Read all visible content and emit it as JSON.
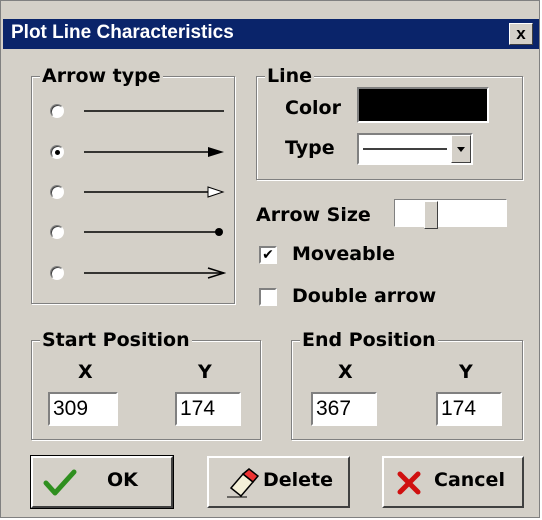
{
  "window": {
    "title": "Plot Line Characteristics",
    "close_label": "x"
  },
  "arrow_type": {
    "legend": "Arrow type",
    "selected_index": 1,
    "options": [
      {
        "style": "plain"
      },
      {
        "style": "filled-arrowhead"
      },
      {
        "style": "open-arrowhead"
      },
      {
        "style": "dot-end"
      },
      {
        "style": "line-arrowhead"
      }
    ]
  },
  "line": {
    "legend": "Line",
    "color_label": "Color",
    "color_value": "#000000",
    "type_label": "Type"
  },
  "arrow_size": {
    "label": "Arrow Size",
    "level": 0.3
  },
  "moveable": {
    "label": "Moveable",
    "checked": true,
    "mark": "✔"
  },
  "double_arrow": {
    "label": "Double arrow",
    "checked": false,
    "mark": ""
  },
  "start_position": {
    "legend": "Start Position",
    "x_label": "X",
    "y_label": "Y",
    "x": "309",
    "y": "174"
  },
  "end_position": {
    "legend": "End Position",
    "x_label": "X",
    "y_label": "Y",
    "x": "367",
    "y": "174"
  },
  "buttons": {
    "ok": {
      "label": "OK",
      "icon": "checkmark-icon"
    },
    "delete": {
      "label": "Delete",
      "icon": "eraser-icon"
    },
    "cancel": {
      "label": "Cancel",
      "icon": "x-icon"
    }
  },
  "colors": {
    "title_bar": "#0a246a",
    "face": "#d4d0c8",
    "ok_check": "#2f8f1f",
    "cancel_x": "#d01010"
  }
}
